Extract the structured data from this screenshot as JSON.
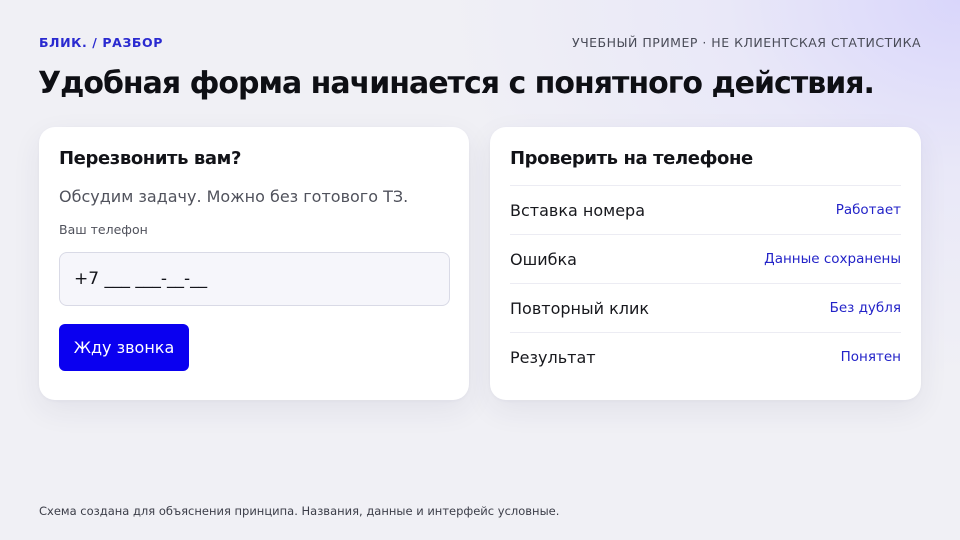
{
  "header": {
    "brand": "БЛИК. / РАЗБОР",
    "tagline": "УЧЕБНЫЙ ПРИМЕР · НЕ КЛИЕНТСКАЯ СТАТИСТИКА",
    "title": "Удобная форма начинается с понятного действия."
  },
  "callback_form": {
    "title": "Перезвонить вам?",
    "subtitle": "Обсудим задачу. Можно без готового ТЗ.",
    "phone_label": "Ваш телефон",
    "phone_value": "+7 ___ ___-__-__",
    "submit_label": "Жду звонка"
  },
  "phone_check": {
    "title": "Проверить на телефоне",
    "items": [
      {
        "name": "Вставка номера",
        "status": "Работает"
      },
      {
        "name": "Ошибка",
        "status": "Данные сохранены"
      },
      {
        "name": "Повторный клик",
        "status": "Без дубля"
      },
      {
        "name": "Результат",
        "status": "Понятен"
      }
    ]
  },
  "footer": {
    "note": "Схема создана для объяснения принципа. Названия, данные и интерфейс условные."
  },
  "colors": {
    "accent": "#0a00f0",
    "link": "#2323c8",
    "background": "#f0f0f5"
  }
}
